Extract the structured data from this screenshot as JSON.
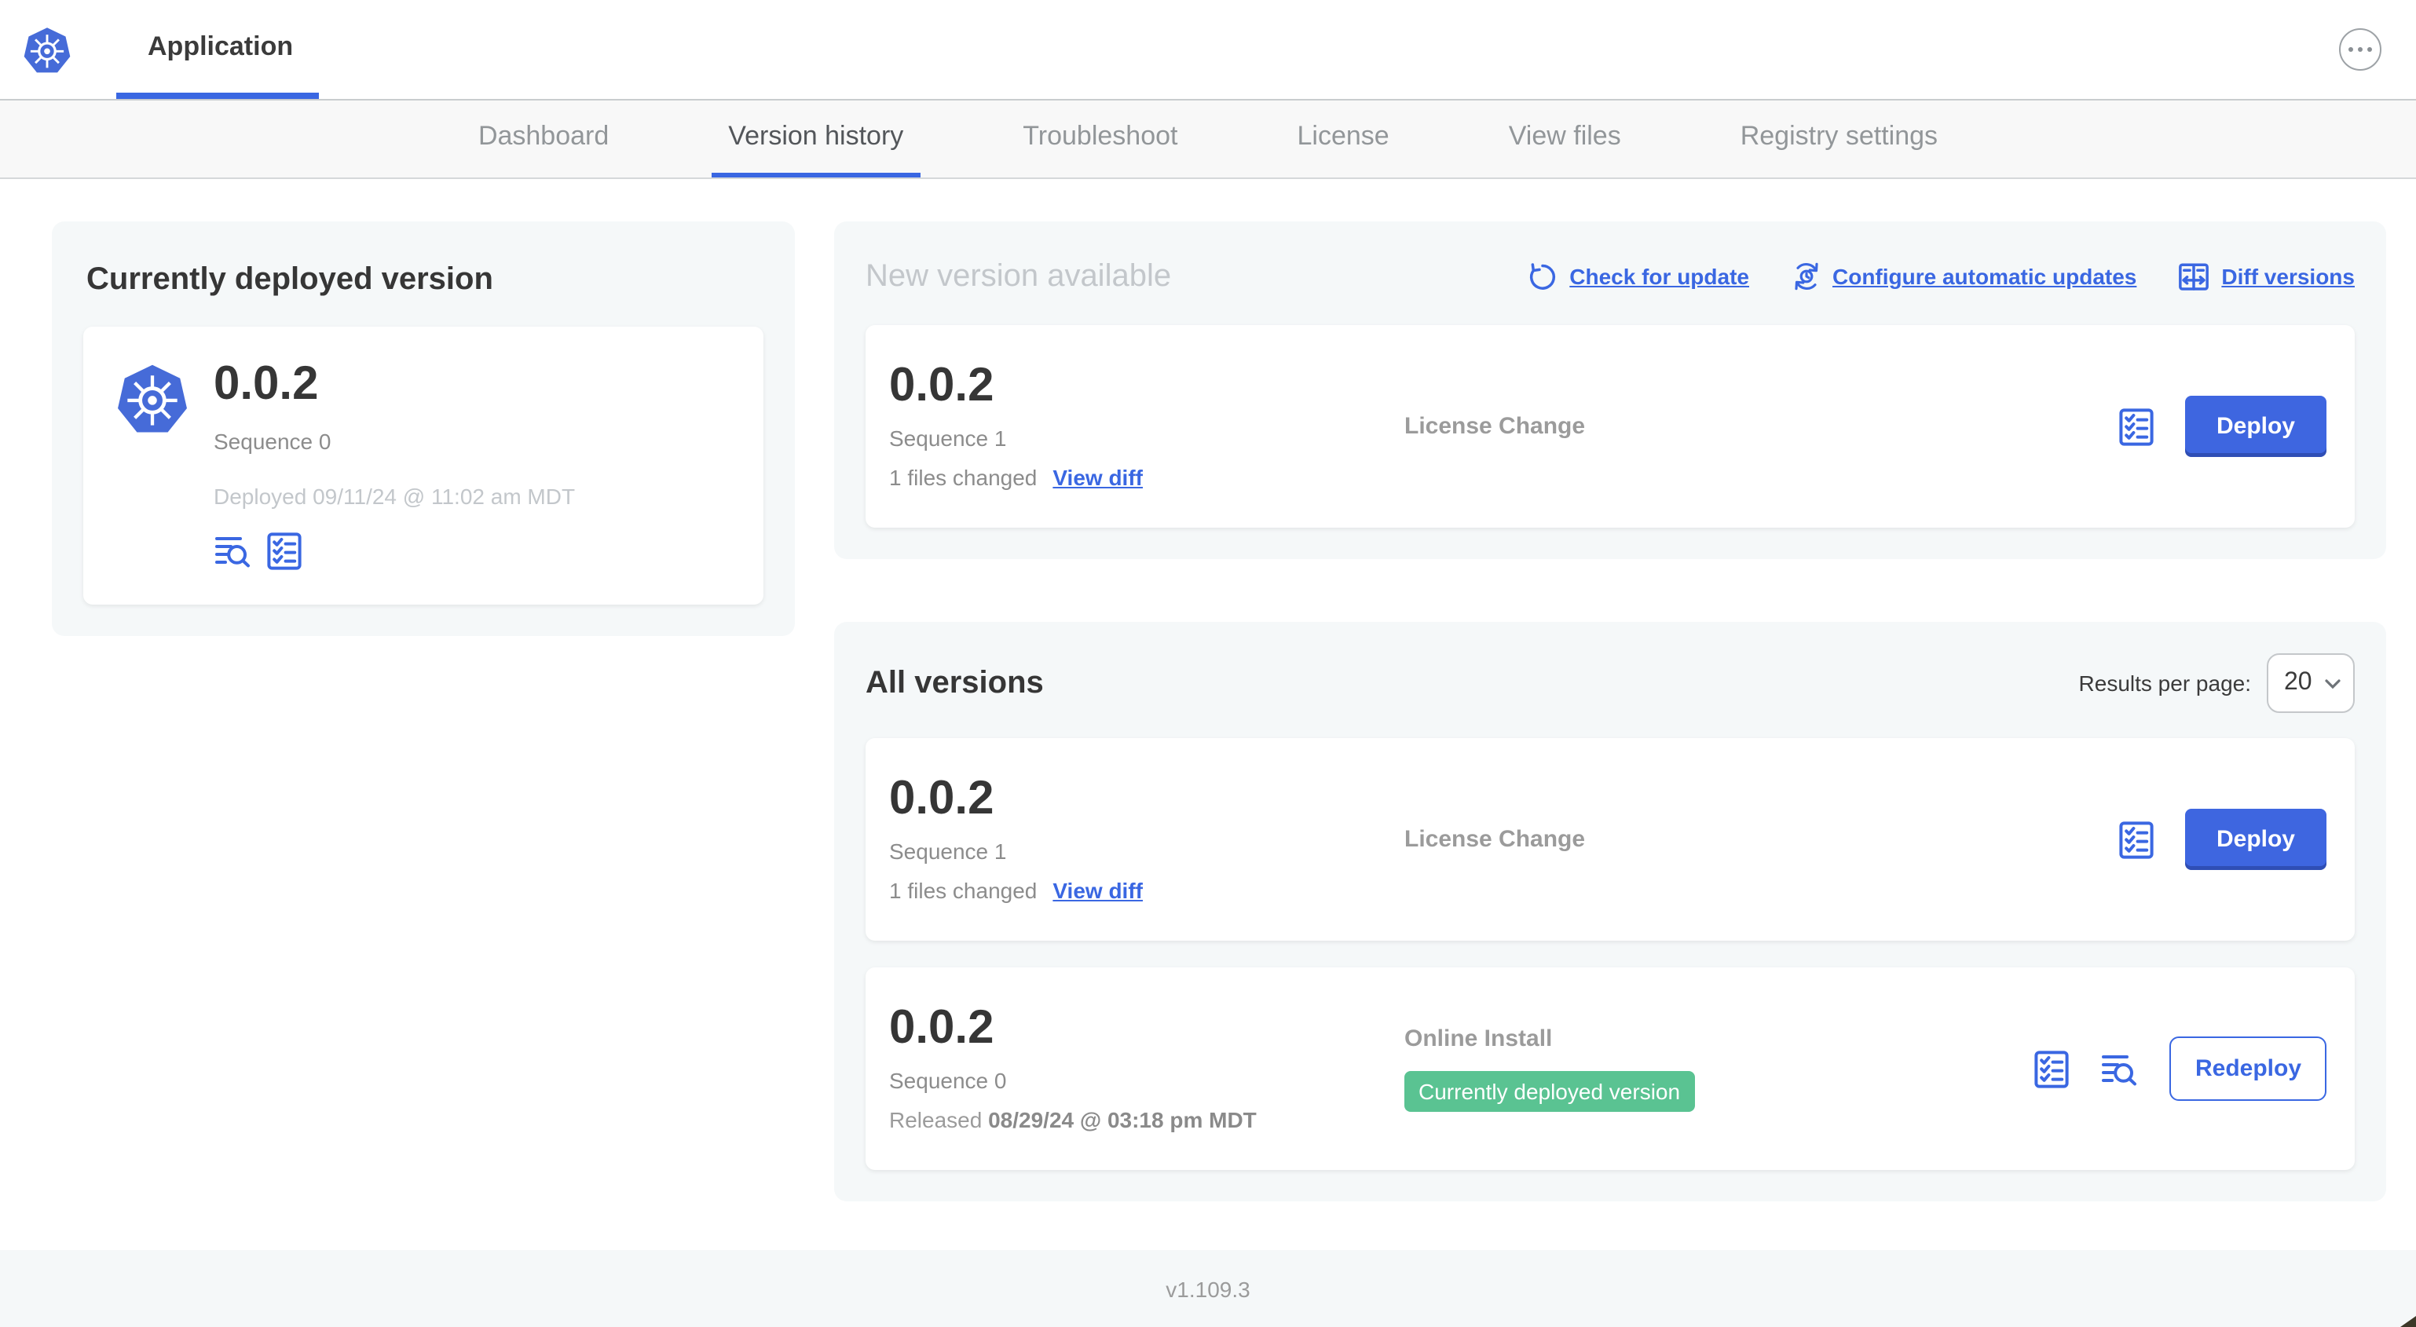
{
  "header": {
    "app_name": "Application"
  },
  "nav": {
    "tabs": [
      {
        "label": "Dashboard"
      },
      {
        "label": "Version history"
      },
      {
        "label": "Troubleshoot"
      },
      {
        "label": "License"
      },
      {
        "label": "View files"
      },
      {
        "label": "Registry settings"
      }
    ]
  },
  "current": {
    "title": "Currently deployed version",
    "version": "0.0.2",
    "sequence": "Sequence 0",
    "deployed": "Deployed 09/11/24 @ 11:02 am MDT"
  },
  "new_version": {
    "title": "New version available",
    "actions": {
      "check": "Check for update",
      "configure": "Configure automatic updates",
      "diff": "Diff versions"
    },
    "card": {
      "version": "0.0.2",
      "sequence": "Sequence 1",
      "files_changed": "1 files changed",
      "view_diff": "View diff",
      "source": "License Change",
      "deploy_label": "Deploy"
    }
  },
  "all_versions": {
    "title": "All versions",
    "results_label": "Results per page:",
    "results_value": "20",
    "rows": [
      {
        "version": "0.0.2",
        "sequence": "Sequence 1",
        "files_changed": "1 files changed",
        "view_diff": "View diff",
        "source": "License Change",
        "action_label": "Deploy"
      },
      {
        "version": "0.0.2",
        "sequence": "Sequence 0",
        "released_prefix": "Released ",
        "released_date": "08/29/24 @ 03:18 pm MDT",
        "source": "Online Install",
        "badge": "Currently deployed version",
        "action_label": "Redeploy"
      }
    ]
  },
  "footer": {
    "version": "v1.109.3"
  },
  "colors": {
    "accent_blue": "#3a67e2",
    "badge_green": "#5ac392"
  }
}
